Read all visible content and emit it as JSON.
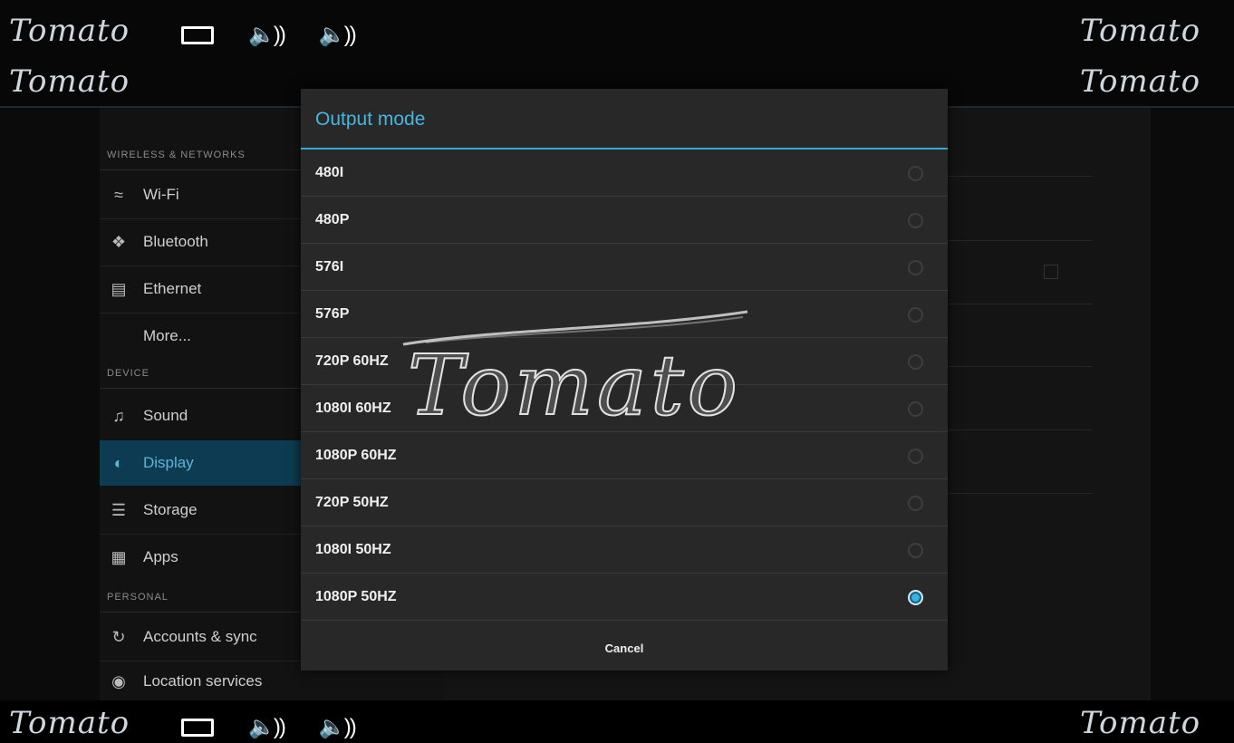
{
  "watermark": {
    "small_text": "Tomato",
    "big_text": "Tomato"
  },
  "status_bar": {
    "icons": [
      "recent-apps-icon",
      "volume-icon",
      "volume-icon"
    ]
  },
  "settings": {
    "sections": [
      {
        "header": "WIRELESS & NETWORKS",
        "items": [
          {
            "label": "Wi-Fi",
            "icon": "wifi-icon"
          },
          {
            "label": "Bluetooth",
            "icon": "bluetooth-icon"
          },
          {
            "label": "Ethernet",
            "icon": "ethernet-icon"
          },
          {
            "label": "More...",
            "icon": ""
          }
        ]
      },
      {
        "header": "DEVICE",
        "items": [
          {
            "label": "Sound",
            "icon": "sound-icon"
          },
          {
            "label": "Display",
            "icon": "display-icon",
            "selected": true
          },
          {
            "label": "Storage",
            "icon": "storage-icon"
          },
          {
            "label": "Apps",
            "icon": "apps-icon"
          }
        ]
      },
      {
        "header": "PERSONAL",
        "items": [
          {
            "label": "Accounts & sync",
            "icon": "sync-icon"
          },
          {
            "label": "Location services",
            "icon": "location-icon"
          }
        ]
      }
    ]
  },
  "dialog": {
    "title": "Output mode",
    "options": [
      {
        "label": "480I",
        "selected": false
      },
      {
        "label": "480P",
        "selected": false
      },
      {
        "label": "576I",
        "selected": false
      },
      {
        "label": "576P",
        "selected": false
      },
      {
        "label": "720P 60HZ",
        "selected": false
      },
      {
        "label": "1080I 60HZ",
        "selected": false
      },
      {
        "label": "1080P 60HZ",
        "selected": false
      },
      {
        "label": "720P 50HZ",
        "selected": false
      },
      {
        "label": "1080I 50HZ",
        "selected": false
      },
      {
        "label": "1080P 50HZ",
        "selected": true
      }
    ],
    "cancel_label": "Cancel"
  },
  "colors": {
    "accent": "#33b5e5",
    "selected_bg": "#0d3c52",
    "dialog_bg": "#282828"
  }
}
